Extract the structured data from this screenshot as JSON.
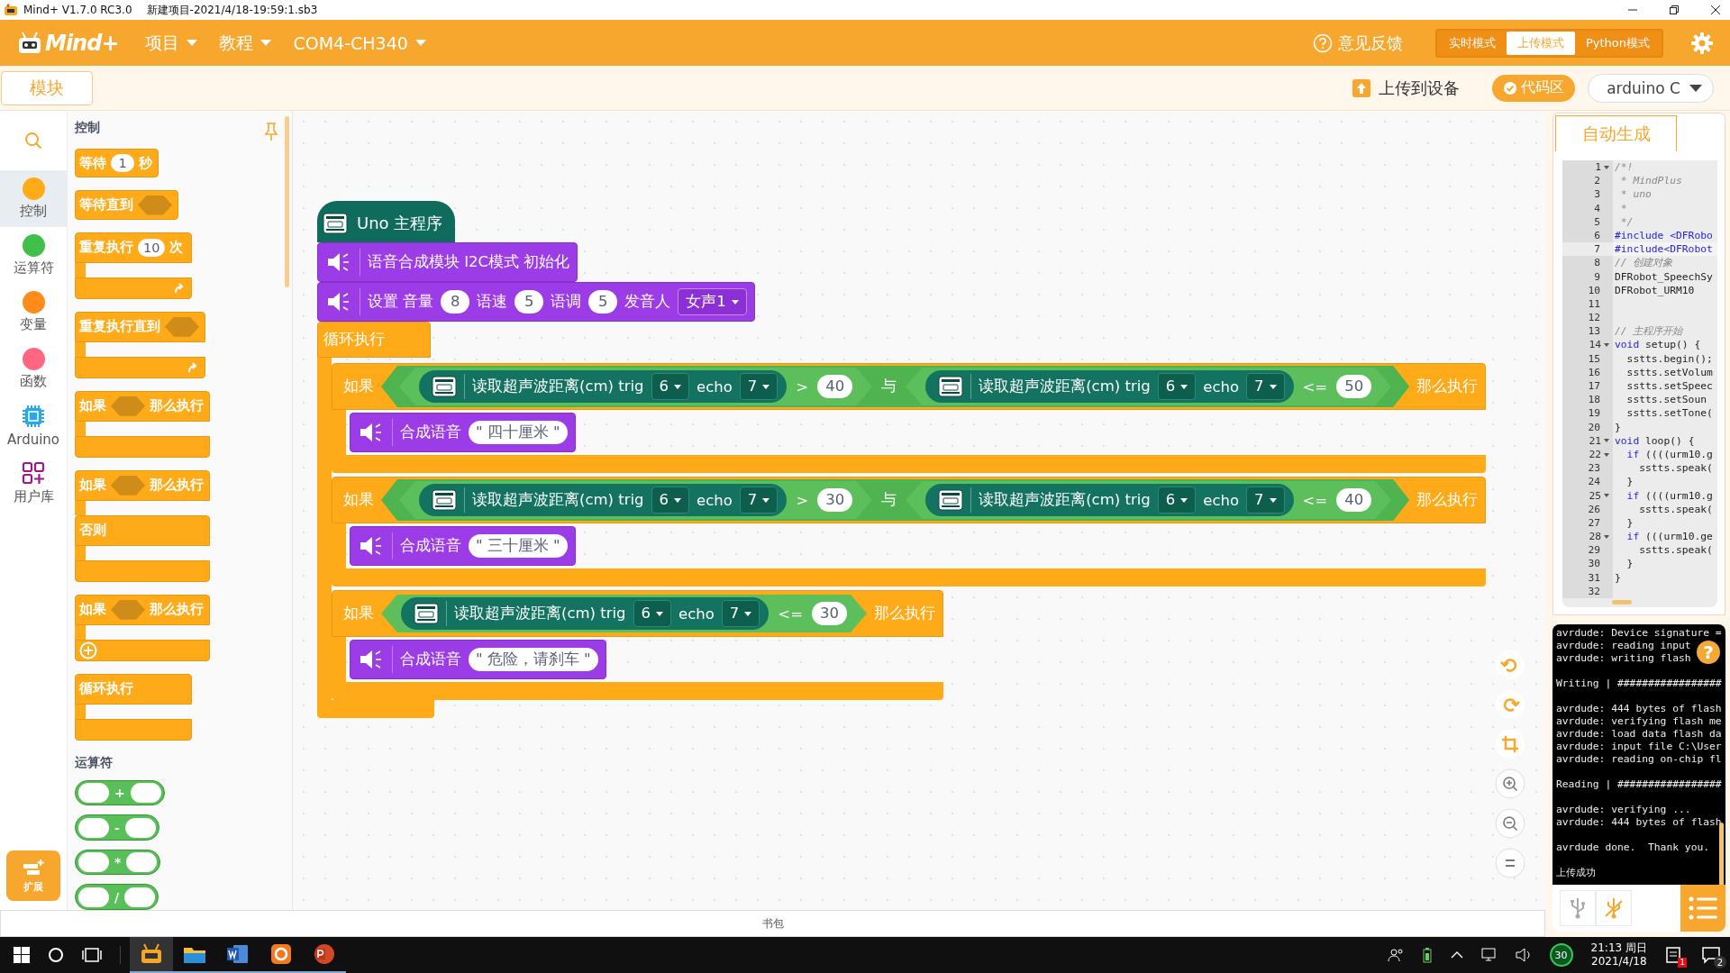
{
  "window": {
    "title": "Mind+ V1.7.0 RC3.0",
    "file": "新建项目-2021/4/18-19:59:1.sb3"
  },
  "menubar": {
    "logo": "Mind+",
    "menus": [
      "项目",
      "教程",
      "COM4-CH340"
    ],
    "feedback": "意见反馈",
    "modes": [
      {
        "label": "实时模式",
        "selected": false
      },
      {
        "label": "上传模式",
        "selected": true
      },
      {
        "label": "Python模式",
        "selected": false
      }
    ]
  },
  "toolbar": {
    "tab": "模块",
    "upload": "上传到设备",
    "code_toggle": {
      "label": "代码区",
      "on": true
    },
    "language": "arduino C"
  },
  "categories": [
    {
      "kind": "search"
    },
    {
      "kind": "dot",
      "label": "控制",
      "color": "#ffab19",
      "selected": true
    },
    {
      "kind": "dot",
      "label": "运算符",
      "color": "#40bf4a",
      "selected": false
    },
    {
      "kind": "dot",
      "label": "变量",
      "color": "#ff8c1a",
      "selected": false
    },
    {
      "kind": "dot",
      "label": "函数",
      "color": "#ff6680",
      "selected": false
    },
    {
      "kind": "chip",
      "label": "Arduino",
      "selected": false
    },
    {
      "kind": "grid",
      "label": "用户库",
      "selected": false
    }
  ],
  "extensions": "扩展",
  "palette": [
    {
      "title": "控制",
      "blocks": [
        {
          "kind": "stack",
          "parts": [
            {
              "kind": "text",
              "text": "等待"
            },
            {
              "kind": "num",
              "text": "1"
            },
            {
              "kind": "text",
              "text": "秒"
            }
          ]
        },
        {
          "kind": "stack",
          "parts": [
            {
              "kind": "text",
              "text": "等待直到"
            },
            {
              "kind": "slot"
            }
          ]
        },
        {
          "kind": "c",
          "repeat": true,
          "expand": false,
          "parts": [
            {
              "kind": "text",
              "text": "重复执行"
            },
            {
              "kind": "num",
              "text": "10"
            },
            {
              "kind": "text",
              "text": "次"
            }
          ]
        },
        {
          "kind": "c",
          "repeat": true,
          "expand": false,
          "parts": [
            {
              "kind": "text",
              "text": "重复执行直到"
            },
            {
              "kind": "slot"
            }
          ]
        },
        {
          "kind": "c",
          "repeat": false,
          "expand": false,
          "parts": [
            {
              "kind": "text",
              "text": "如果"
            },
            {
              "kind": "slot"
            },
            {
              "kind": "text",
              "text": "那么执行"
            }
          ]
        },
        {
          "kind": "c",
          "repeat": false,
          "expand": false,
          "else_label": "否则",
          "parts": [
            {
              "kind": "text",
              "text": "如果"
            },
            {
              "kind": "slot"
            },
            {
              "kind": "text",
              "text": "那么执行"
            }
          ]
        },
        {
          "kind": "c",
          "repeat": false,
          "expand": true,
          "parts": [
            {
              "kind": "text",
              "text": "如果"
            },
            {
              "kind": "slot"
            },
            {
              "kind": "text",
              "text": "那么执行"
            }
          ]
        },
        {
          "kind": "c",
          "repeat": false,
          "expand": false,
          "parts": [
            {
              "kind": "text",
              "text": "循环执行"
            }
          ]
        }
      ]
    },
    {
      "title": "运算符",
      "blocks": [
        {
          "kind": "op",
          "op": "+"
        },
        {
          "kind": "op",
          "op": "-"
        },
        {
          "kind": "op",
          "op": "*"
        },
        {
          "kind": "op",
          "op": "/"
        }
      ]
    }
  ],
  "program": {
    "hat": "Uno 主程序",
    "statements": [
      {
        "kind": "speech",
        "parts": [
          {
            "kind": "text",
            "text": "语音合成模块 I2C模式 初始化"
          }
        ]
      },
      {
        "kind": "speech",
        "parts": [
          {
            "kind": "text",
            "text": "设置 音量"
          },
          {
            "kind": "num",
            "text": "8"
          },
          {
            "kind": "text",
            "text": "语速"
          },
          {
            "kind": "num",
            "text": "5"
          },
          {
            "kind": "text",
            "text": "语调"
          },
          {
            "kind": "num",
            "text": "5"
          },
          {
            "kind": "text",
            "text": "发音人"
          },
          {
            "kind": "dropdown",
            "text": "女声1"
          }
        ]
      },
      {
        "kind": "loop",
        "label": "循环执行",
        "children": [
          {
            "kind": "if",
            "label": "如果",
            "then": "那么执行",
            "condition": {
              "kind": "and",
              "op": "与",
              "left": {
                "kind": "compare",
                "reading": "读取超声波距离(cm) trig",
                "trig": "6",
                "echo_label": "echo",
                "echo": "7",
                "op": ">",
                "value": "40"
              },
              "right": {
                "kind": "compare",
                "reading": "读取超声波距离(cm) trig",
                "trig": "6",
                "echo_label": "echo",
                "echo": "7",
                "op": "<=",
                "value": "50"
              }
            },
            "children": [
              {
                "kind": "speech",
                "parts": [
                  {
                    "kind": "text",
                    "text": "合成语音"
                  },
                  {
                    "kind": "string",
                    "text": "\" 四十厘米 \""
                  }
                ]
              }
            ]
          },
          {
            "kind": "if",
            "label": "如果",
            "then": "那么执行",
            "condition": {
              "kind": "and",
              "op": "与",
              "left": {
                "kind": "compare",
                "reading": "读取超声波距离(cm) trig",
                "trig": "6",
                "echo_label": "echo",
                "echo": "7",
                "op": ">",
                "value": "30"
              },
              "right": {
                "kind": "compare",
                "reading": "读取超声波距离(cm) trig",
                "trig": "6",
                "echo_label": "echo",
                "echo": "7",
                "op": "<=",
                "value": "40"
              }
            },
            "children": [
              {
                "kind": "speech",
                "parts": [
                  {
                    "kind": "text",
                    "text": "合成语音"
                  },
                  {
                    "kind": "string",
                    "text": "\" 三十厘米 \""
                  }
                ]
              }
            ]
          },
          {
            "kind": "if",
            "label": "如果",
            "then": "那么执行",
            "condition": {
              "kind": "compare",
              "reading": "读取超声波距离(cm) trig",
              "trig": "6",
              "echo_label": "echo",
              "echo": "7",
              "op": "<=",
              "value": "30"
            },
            "children": [
              {
                "kind": "speech",
                "parts": [
                  {
                    "kind": "text",
                    "text": "合成语音"
                  },
                  {
                    "kind": "string",
                    "text": "\" 危险，请刹车 \""
                  }
                ]
              }
            ]
          }
        ]
      }
    ]
  },
  "backpack": "书包",
  "code_panel": {
    "tab": "自动生成",
    "lines": [
      {
        "n": "1",
        "fold": true,
        "current": false,
        "segments": [
          {
            "kind": "comment",
            "text": "/*!"
          }
        ]
      },
      {
        "n": "2",
        "fold": false,
        "current": false,
        "segments": [
          {
            "kind": "comment",
            "text": " * MindPlus"
          }
        ]
      },
      {
        "n": "3",
        "fold": false,
        "current": false,
        "segments": [
          {
            "kind": "comment",
            "text": " * uno"
          }
        ]
      },
      {
        "n": "4",
        "fold": false,
        "current": false,
        "segments": [
          {
            "kind": "comment",
            "text": " *"
          }
        ]
      },
      {
        "n": "5",
        "fold": false,
        "current": false,
        "segments": [
          {
            "kind": "comment",
            "text": " */"
          }
        ]
      },
      {
        "n": "6",
        "fold": false,
        "current": false,
        "segments": [
          {
            "kind": "keyword",
            "text": "#include <DFRobo"
          }
        ]
      },
      {
        "n": "7",
        "fold": false,
        "current": true,
        "segments": [
          {
            "kind": "keyword",
            "text": "#include<DFRobot"
          }
        ]
      },
      {
        "n": "8",
        "fold": false,
        "current": false,
        "segments": [
          {
            "kind": "comment",
            "text": "// 创建对象"
          }
        ]
      },
      {
        "n": "9",
        "fold": false,
        "current": false,
        "segments": [
          {
            "kind": "plain",
            "text": "DFRobot_SpeechSy"
          }
        ]
      },
      {
        "n": "10",
        "fold": false,
        "current": false,
        "segments": [
          {
            "kind": "plain",
            "text": "DFRobot_URM10"
          }
        ]
      },
      {
        "n": "11",
        "fold": false,
        "current": false
      },
      {
        "n": "12",
        "fold": false,
        "current": false
      },
      {
        "n": "13",
        "fold": false,
        "current": false,
        "segments": [
          {
            "kind": "comment",
            "text": "// 主程序开始"
          }
        ]
      },
      {
        "n": "14",
        "fold": true,
        "current": false,
        "segments": [
          {
            "kind": "keyword",
            "text": "void"
          },
          {
            "kind": "plain",
            "text": " setup() {"
          }
        ]
      },
      {
        "n": "15",
        "fold": false,
        "current": false,
        "segments": [
          {
            "kind": "plain",
            "text": "  sstts.begin();"
          }
        ]
      },
      {
        "n": "16",
        "fold": false,
        "current": false,
        "segments": [
          {
            "kind": "plain",
            "text": "  sstts.setVolum"
          }
        ]
      },
      {
        "n": "17",
        "fold": false,
        "current": false,
        "segments": [
          {
            "kind": "plain",
            "text": "  sstts.setSpeec"
          }
        ]
      },
      {
        "n": "18",
        "fold": false,
        "current": false,
        "segments": [
          {
            "kind": "plain",
            "text": "  sstts.setSoun"
          }
        ]
      },
      {
        "n": "19",
        "fold": false,
        "current": false,
        "segments": [
          {
            "kind": "plain",
            "text": "  sstts.setTone("
          }
        ]
      },
      {
        "n": "20",
        "fold": false,
        "current": false,
        "segments": [
          {
            "kind": "plain",
            "text": "}"
          }
        ]
      },
      {
        "n": "21",
        "fold": true,
        "current": false,
        "segments": [
          {
            "kind": "keyword",
            "text": "void"
          },
          {
            "kind": "plain",
            "text": " loop() {"
          }
        ]
      },
      {
        "n": "22",
        "fold": true,
        "current": false,
        "segments": [
          {
            "kind": "keyword",
            "text": "  if"
          },
          {
            "kind": "plain",
            "text": " ((((urm10.g"
          }
        ]
      },
      {
        "n": "23",
        "fold": false,
        "current": false,
        "segments": [
          {
            "kind": "plain",
            "text": "    sstts.speak("
          }
        ]
      },
      {
        "n": "24",
        "fold": false,
        "current": false,
        "segments": [
          {
            "kind": "plain",
            "text": "  }"
          }
        ]
      },
      {
        "n": "25",
        "fold": true,
        "current": false,
        "segments": [
          {
            "kind": "keyword",
            "text": "  if"
          },
          {
            "kind": "plain",
            "text": " ((((urm10.g"
          }
        ]
      },
      {
        "n": "26",
        "fold": false,
        "current": false,
        "segments": [
          {
            "kind": "plain",
            "text": "    sstts.speak("
          }
        ]
      },
      {
        "n": "27",
        "fold": false,
        "current": false,
        "segments": [
          {
            "kind": "plain",
            "text": "  }"
          }
        ]
      },
      {
        "n": "28",
        "fold": true,
        "current": false,
        "segments": [
          {
            "kind": "keyword",
            "text": "  if"
          },
          {
            "kind": "plain",
            "text": " (((urm10.ge"
          }
        ]
      },
      {
        "n": "29",
        "fold": false,
        "current": false,
        "segments": [
          {
            "kind": "plain",
            "text": "    sstts.speak("
          }
        ]
      },
      {
        "n": "30",
        "fold": false,
        "current": false,
        "segments": [
          {
            "kind": "plain",
            "text": "  }"
          }
        ]
      },
      {
        "n": "31",
        "fold": false,
        "current": false,
        "segments": [
          {
            "kind": "plain",
            "text": "}"
          }
        ]
      },
      {
        "n": "32",
        "fold": false,
        "current": false
      }
    ]
  },
  "console": {
    "help": "?",
    "groups": [
      [
        "avrdude: Device signature =",
        "avrdude: reading input",
        "avrdude: writing flash"
      ],
      [
        "Writing | #################"
      ],
      [
        "avrdude: 444 bytes of flash",
        "avrdude: verifying flash me",
        "avrdude: load data flash da",
        "avrdude: input file C:\\User",
        "avrdude: reading on-chip fl"
      ],
      [
        "Reading | #################"
      ],
      [
        "avrdude: verifying ...",
        "avrdude: 444 bytes of flash"
      ],
      [
        "avrdude done.  Thank you."
      ],
      [
        "上传成功"
      ]
    ]
  },
  "taskbar": {
    "tray_badge": "30",
    "time": "21:13 周日",
    "date": "2021/4/18",
    "notifications": "1",
    "actions": "2"
  }
}
